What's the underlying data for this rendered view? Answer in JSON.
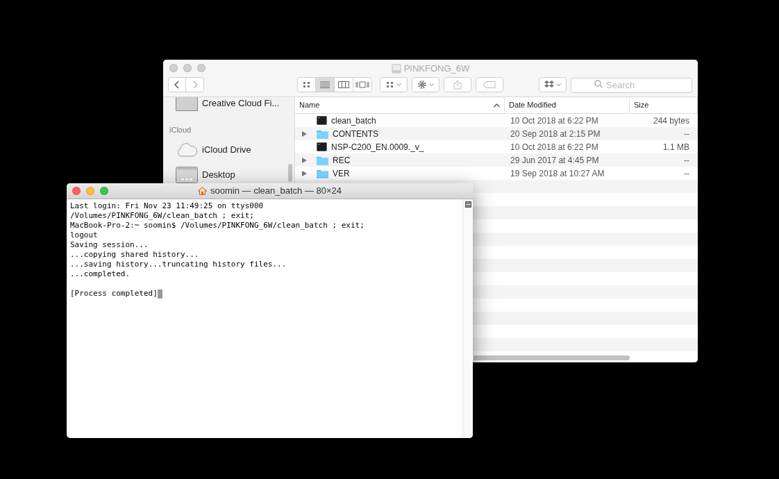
{
  "finder": {
    "title": "PINKFONG_6W",
    "view_modes": [
      {
        "kind": "icons",
        "selected": false
      },
      {
        "kind": "list",
        "selected": true
      },
      {
        "kind": "columns",
        "selected": false
      },
      {
        "kind": "gallery",
        "selected": false
      }
    ],
    "search": {
      "placeholder": "Search"
    },
    "sidebar": {
      "items": [
        {
          "kind": "item",
          "label": "Creative Cloud Fi..."
        },
        {
          "kind": "heading",
          "label": "iCloud"
        },
        {
          "kind": "item",
          "label": "iCloud Drive"
        },
        {
          "kind": "item",
          "label": "Desktop"
        }
      ]
    },
    "table": {
      "columns": [
        {
          "label": "Name",
          "sorted": true
        },
        {
          "label": "Date Modified",
          "sorted": false
        },
        {
          "label": "Size",
          "sorted": false
        }
      ],
      "rows": [
        {
          "kind": "executable",
          "name": "clean_batch",
          "date": "10 Oct 2018 at 6:22 PM",
          "size": "244 bytes"
        },
        {
          "kind": "folder",
          "name": "CONTENTS",
          "date": "20 Sep 2018 at 2:15 PM",
          "size": "--"
        },
        {
          "kind": "executable",
          "name": "NSP-C200_EN.0009._v_",
          "date": "10 Oct 2018 at 6:22 PM",
          "size": "1.1 MB"
        },
        {
          "kind": "folder",
          "name": "REC",
          "date": "29 Jun 2017 at 4:45 PM",
          "size": "--"
        },
        {
          "kind": "folder",
          "name": "VER",
          "date": "19 Sep 2018 at 10:27 AM",
          "size": "--"
        }
      ]
    }
  },
  "terminal": {
    "title": "soomin — clean_batch — 80×24",
    "lines": [
      {
        "kind": "output",
        "text": "Last login: Fri Nov 23 11:49:25 on ttys000"
      },
      {
        "kind": "output",
        "text": "/Volumes/PINKFONG_6W/clean_batch ; exit;"
      },
      {
        "kind": "output",
        "text": "MacBook-Pro-2:~ soomin$ /Volumes/PINKFONG_6W/clean_batch ; exit;"
      },
      {
        "kind": "output",
        "text": "logout"
      },
      {
        "kind": "output",
        "text": "Saving session..."
      },
      {
        "kind": "output",
        "text": "...copying shared history..."
      },
      {
        "kind": "output",
        "text": "...saving history...truncating history files..."
      },
      {
        "kind": "output",
        "text": "...completed."
      },
      {
        "kind": "blank"
      },
      {
        "kind": "output",
        "text": "[Process completed]"
      }
    ]
  }
}
